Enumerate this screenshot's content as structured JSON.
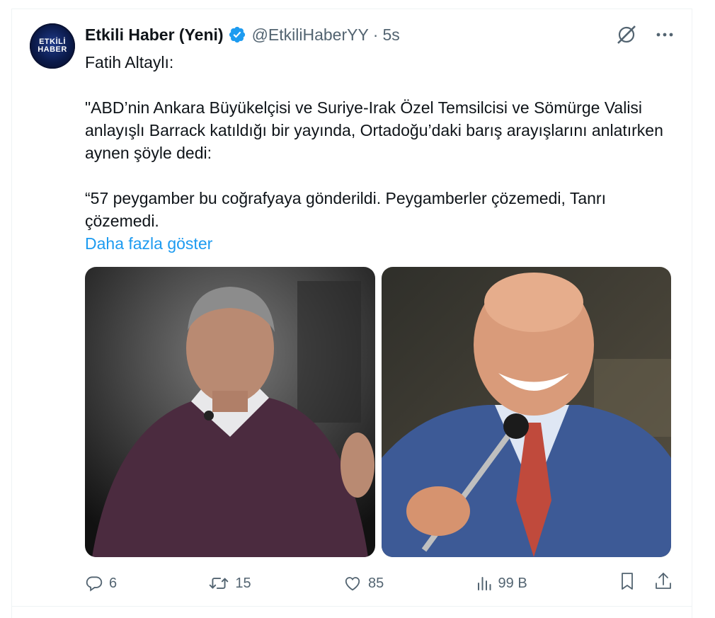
{
  "tweet": {
    "author_name": "Etkili Haber (Yeni)",
    "handle": "@EtkiliHaberYY",
    "separator": "·",
    "time": "5s",
    "avatar_line1": "ETKİLİ",
    "avatar_line2": "HABER",
    "paragraphs": [
      "Fatih Altaylı:",
      "\"ABD’nin Ankara Büyükelçisi ve Suriye-Irak Özel Temsilcisi ve Sömürge Valisi anlayışlı Barrack katıldığı bir yayında, Ortadoğu’daki barış arayışlarını anlatırken aynen şöyle dedi:",
      "“57 peygamber bu coğrafyaya gönderildi. Peygamberler çözemedi, Tanrı çözemedi."
    ],
    "show_more": "Daha fazla göster"
  },
  "actions": {
    "replies": "6",
    "reposts": "15",
    "likes": "85",
    "views": "99 B"
  },
  "colors": {
    "accent": "#1d9bf0",
    "muted": "#536471",
    "text": "#0f1419"
  },
  "icons": [
    "verified-badge-icon",
    "grok-icon",
    "more-options-icon",
    "reply-icon",
    "repost-icon",
    "like-icon",
    "views-icon",
    "bookmark-icon",
    "share-icon"
  ]
}
